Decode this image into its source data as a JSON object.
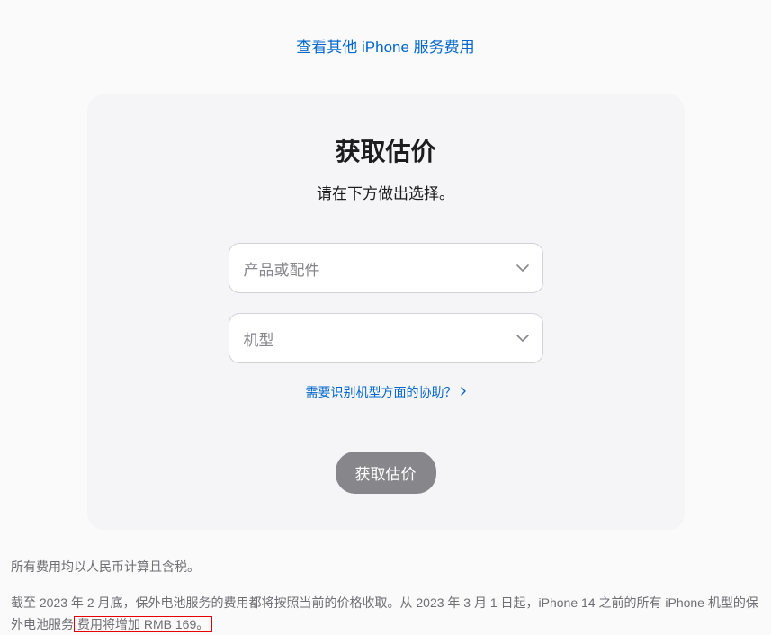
{
  "topLink": {
    "text": "查看其他 iPhone 服务费用"
  },
  "card": {
    "title": "获取估价",
    "subtitle": "请在下方做出选择。"
  },
  "selects": {
    "product": {
      "placeholder": "产品或配件"
    },
    "model": {
      "placeholder": "机型"
    }
  },
  "helpLink": {
    "text": "需要识别机型方面的协助？"
  },
  "button": {
    "label": "获取估价"
  },
  "footer": {
    "line1": "所有费用均以人民币计算且含税。",
    "line2_part1": "截至 2023 年 2 月底，保外电池服务的费用都将按照当前的价格收取。从 2023 年 3 月 1 日起，iPhone 14 之前的所有 iPhone 机型的保外电池服务",
    "line2_highlight": "费用将增加 RMB 169。"
  }
}
